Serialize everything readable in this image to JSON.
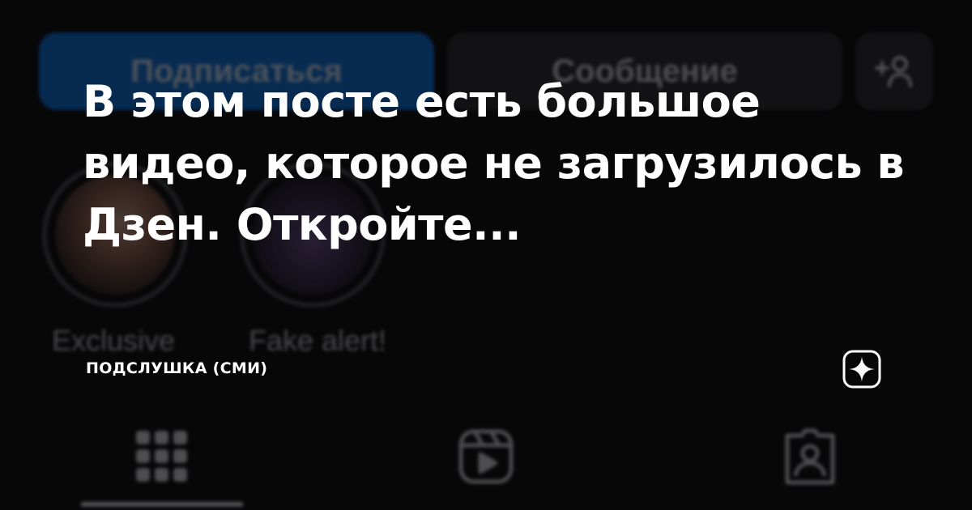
{
  "background_ui": {
    "follow_button_label": "Подписаться",
    "message_button_label": "Сообщение",
    "add_user_icon": "add-user-icon",
    "highlights": [
      {
        "label": "Exclusive"
      },
      {
        "label": "Fake alert!"
      }
    ],
    "tabs": [
      {
        "icon": "grid-icon"
      },
      {
        "icon": "reels-icon"
      },
      {
        "icon": "tagged-icon"
      }
    ],
    "colors": {
      "follow_button": "#0e6fd8",
      "secondary_button": "#2b2b2f"
    }
  },
  "overlay": {
    "headline": "В этом посте есть большое видео, которое не загрузилось в Дзен. Откройте...",
    "source": "ПОДСЛУШКА (СМИ)",
    "brand_icon": "dzen-star-icon"
  }
}
